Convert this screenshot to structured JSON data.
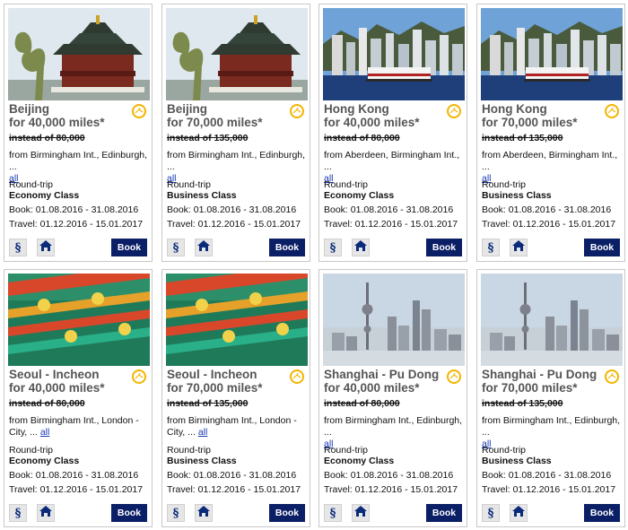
{
  "cards": [
    {
      "title_line1": "Beijing",
      "title_line2": "for 40,000 miles*",
      "old_price": "instead of 80,000",
      "from_text": "from Birmingham Int., Edinburgh, ...",
      "all_link": "all",
      "trip": "Round-trip",
      "class": "Economy Class",
      "book": "Book: 01.08.2016 - 31.08.2016",
      "travel": "Travel: 01.12.2016 - 15.01.2017",
      "book_button": "Book",
      "photo": "beijing-temple",
      "rules_icon": "§"
    },
    {
      "title_line1": "Beijing",
      "title_line2": "for 70,000 miles*",
      "old_price": "instead of 135,000",
      "from_text": "from Birmingham Int., Edinburgh, ...",
      "all_link": "all",
      "trip": "Round-trip",
      "class": "Business Class",
      "book": "Book: 01.08.2016 - 31.08.2016",
      "travel": "Travel: 01.12.2016 - 15.01.2017",
      "book_button": "Book",
      "photo": "beijing-temple",
      "rules_icon": "§"
    },
    {
      "title_line1": "Hong Kong",
      "title_line2": "for 40,000 miles*",
      "old_price": "instead of 80,000",
      "from_text": "from Aberdeen, Birmingham Int., ...",
      "all_link": "all",
      "trip": "Round-trip",
      "class": "Economy Class",
      "book": "Book: 01.08.2016 - 31.08.2016",
      "travel": "Travel: 01.12.2016 - 15.01.2017",
      "book_button": "Book",
      "photo": "hongkong-skyline",
      "rules_icon": "§"
    },
    {
      "title_line1": "Hong Kong",
      "title_line2": "for 70,000 miles*",
      "old_price": "instead of 135,000",
      "from_text": "from Aberdeen, Birmingham Int., ...",
      "all_link": "all",
      "trip": "Round-trip",
      "class": "Business Class",
      "book": "Book: 01.08.2016 - 31.08.2016",
      "travel": "Travel: 01.12.2016 - 15.01.2017",
      "book_button": "Book",
      "photo": "hongkong-skyline",
      "rules_icon": "§"
    },
    {
      "title_line1": "Seoul - Incheon",
      "title_line2": "for 40,000 miles*",
      "old_price": "instead of 80,000",
      "from_text": "from Birmingham Int., London - City, ...",
      "all_link": "all",
      "trip": "Round-trip",
      "class": "Economy Class",
      "book": "Book: 01.08.2016 - 31.08.2016",
      "travel": "Travel: 01.12.2016 - 15.01.2017",
      "book_button": "Book",
      "photo": "seoul-roof",
      "rules_icon": "§"
    },
    {
      "title_line1": "Seoul - Incheon",
      "title_line2": "for 70,000 miles*",
      "old_price": "instead of 135,000",
      "from_text": "from Birmingham Int., London - City, ...",
      "all_link": "all",
      "trip": "Round-trip",
      "class": "Business Class",
      "book": "Book: 01.08.2016 - 31.08.2016",
      "travel": "Travel: 01.12.2016 - 15.01.2017",
      "book_button": "Book",
      "photo": "seoul-roof",
      "rules_icon": "§"
    },
    {
      "title_line1": "Shanghai - Pu Dong",
      "title_line2": "for 40,000 miles*",
      "old_price": "instead of 80,000",
      "from_text": "from Birmingham Int., Edinburgh, ...",
      "all_link": "all",
      "trip": "Round-trip",
      "class": "Economy Class",
      "book": "Book: 01.08.2016 - 31.08.2016",
      "travel": "Travel: 01.12.2016 - 15.01.2017",
      "book_button": "Book",
      "photo": "shanghai-skyline",
      "rules_icon": "§"
    },
    {
      "title_line1": "Shanghai - Pu Dong",
      "title_line2": "for 70,000 miles*",
      "old_price": "instead of 135,000",
      "from_text": "from Birmingham Int., Edinburgh, ...",
      "all_link": "all",
      "trip": "Round-trip",
      "class": "Business Class",
      "book": "Book: 01.08.2016 - 31.08.2016",
      "travel": "Travel: 01.12.2016 - 15.01.2017",
      "book_button": "Book",
      "photo": "shanghai-skyline",
      "rules_icon": "§"
    }
  ],
  "colors": {
    "brand_navy": "#0b1f66",
    "logo_yellow": "#f2b500",
    "link_blue": "#1a3ab3",
    "title_grey": "#555555"
  },
  "icons": {
    "rules": "paragraph-icon",
    "home": "home-icon",
    "airline": "airline-logo-icon"
  }
}
